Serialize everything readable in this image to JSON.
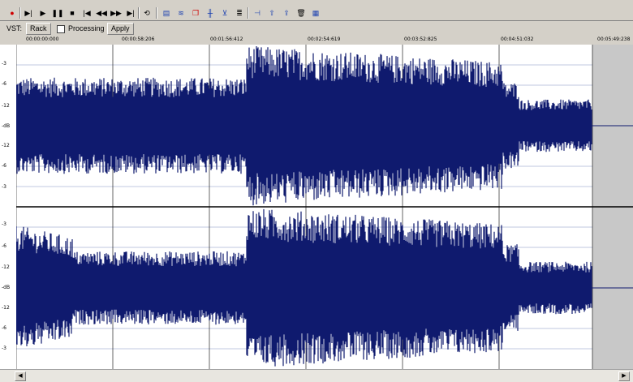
{
  "toolbar": {
    "vst_label": "VST:",
    "rack_label": "Rack",
    "processing_label": "Processing",
    "apply_label": "Apply"
  },
  "ruler": {
    "ticks": [
      "00:00:00:000",
      "00:00:58:206",
      "00:01:56:412",
      "00:02:54:619",
      "00:03:52:825",
      "00:04:51:032",
      "00:05:49:238"
    ]
  },
  "db_scale": {
    "channel1": [
      "-3",
      "-6",
      "-12",
      "-dB",
      "-12",
      "-6",
      "-3"
    ],
    "channel2": [
      "-3",
      "-6",
      "-12",
      "-dB",
      "-12",
      "-6",
      "-3"
    ]
  },
  "colors": {
    "waveform": "#0f1a6e",
    "background": "#ffffff",
    "unused_region": "#c8c8c8",
    "toolbar": "#d4d0c8"
  }
}
